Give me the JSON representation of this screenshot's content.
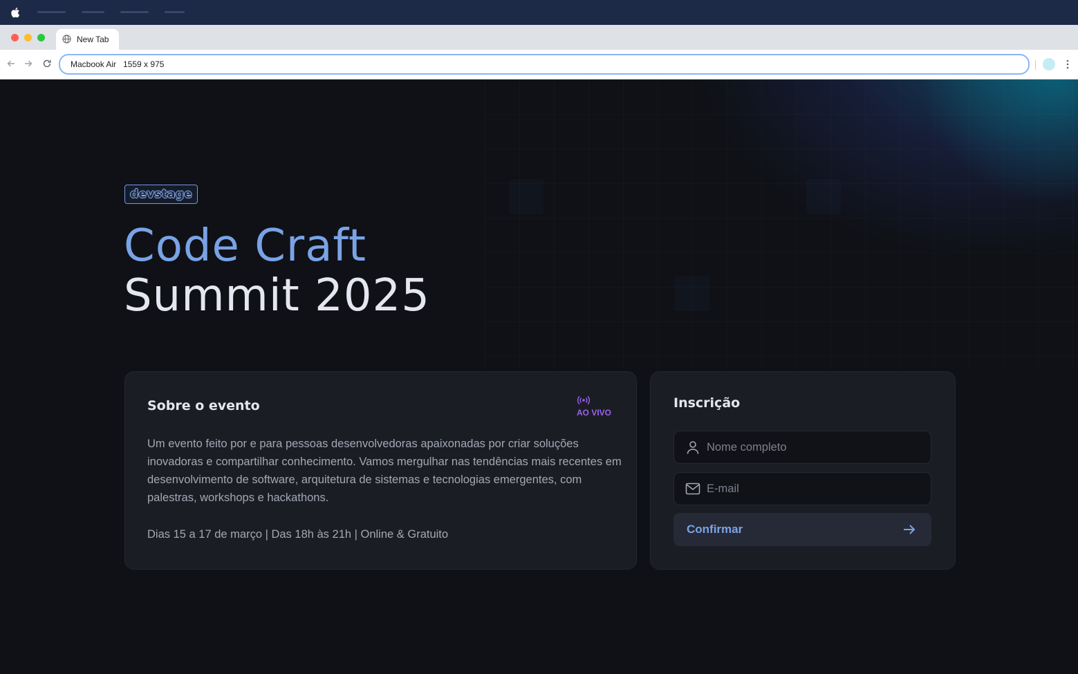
{
  "os": {
    "menu_icon": "apple-icon"
  },
  "browser": {
    "tab_title": "New Tab",
    "address_bar": "Macbook Air   1559 x 975",
    "icons": [
      "back-arrow-icon",
      "forward-arrow-icon",
      "reload-icon",
      "globe-icon",
      "profile-icon",
      "kebab-menu-icon"
    ],
    "traffic_lights": [
      "#ff5f57",
      "#febc2e",
      "#28c840"
    ]
  },
  "page": {
    "logo_text": "devstage",
    "hero_line1": "Code Craft",
    "hero_line2": "Summit 2025",
    "colors": {
      "background": "#0f1116",
      "accent": "#7aa3e6",
      "card": "#1b1d24",
      "live": "#9b63f0"
    },
    "about": {
      "title": "Sobre o evento",
      "live_badge": "AO VIVO",
      "live_icon": "broadcast-icon",
      "description": "Um evento feito por e para pessoas desenvolvedoras apaixonadas por criar soluções inovadoras e compartilhar conhecimento. Vamos mergulhar nas tendências mais recentes em desenvolvimento de software, arquitetura de sistemas e tecnologias emergentes, com palestras, workshops e hackathons.",
      "info": "Dias 15 a 17 de março | Das 18h às 21h | Online & Gratuito"
    },
    "form": {
      "title": "Inscrição",
      "name_placeholder": "Nome completo",
      "name_icon": "user-icon",
      "email_placeholder": "E-mail",
      "email_icon": "mail-icon",
      "submit_label": "Confirmar",
      "submit_icon": "arrow-right-icon"
    }
  }
}
